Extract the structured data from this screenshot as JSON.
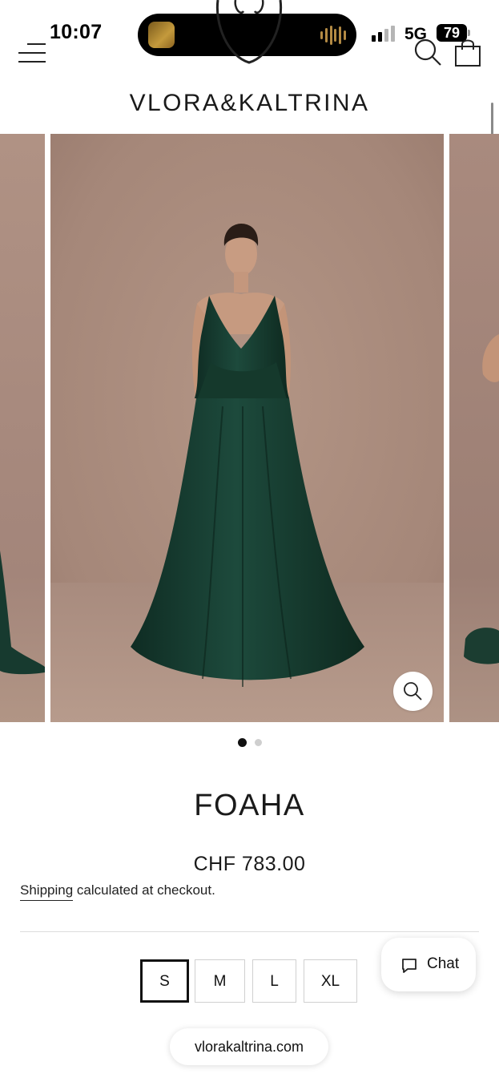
{
  "status_bar": {
    "time": "10:07",
    "network": "5G",
    "battery": "79"
  },
  "header": {
    "brand": "VLORA&KALTRINA",
    "icons": [
      "menu-icon",
      "search-icon",
      "cart-icon"
    ]
  },
  "gallery": {
    "slides_visible": 3,
    "dots": [
      "active",
      "inactive"
    ],
    "zoom_icon": "zoom-icon"
  },
  "product": {
    "title": "FOAHA",
    "price": "CHF 783.00",
    "shipping_link": "Shipping",
    "shipping_rest": " calculated at checkout."
  },
  "sizes": {
    "options": [
      "S",
      "M",
      "L",
      "XL"
    ],
    "selected": "S"
  },
  "chat": {
    "label": "Chat"
  },
  "browser": {
    "url": "vlorakaltrina.com"
  },
  "colors": {
    "backdrop": "#a6897c",
    "dress": "#17392f",
    "accent": "#111111"
  }
}
